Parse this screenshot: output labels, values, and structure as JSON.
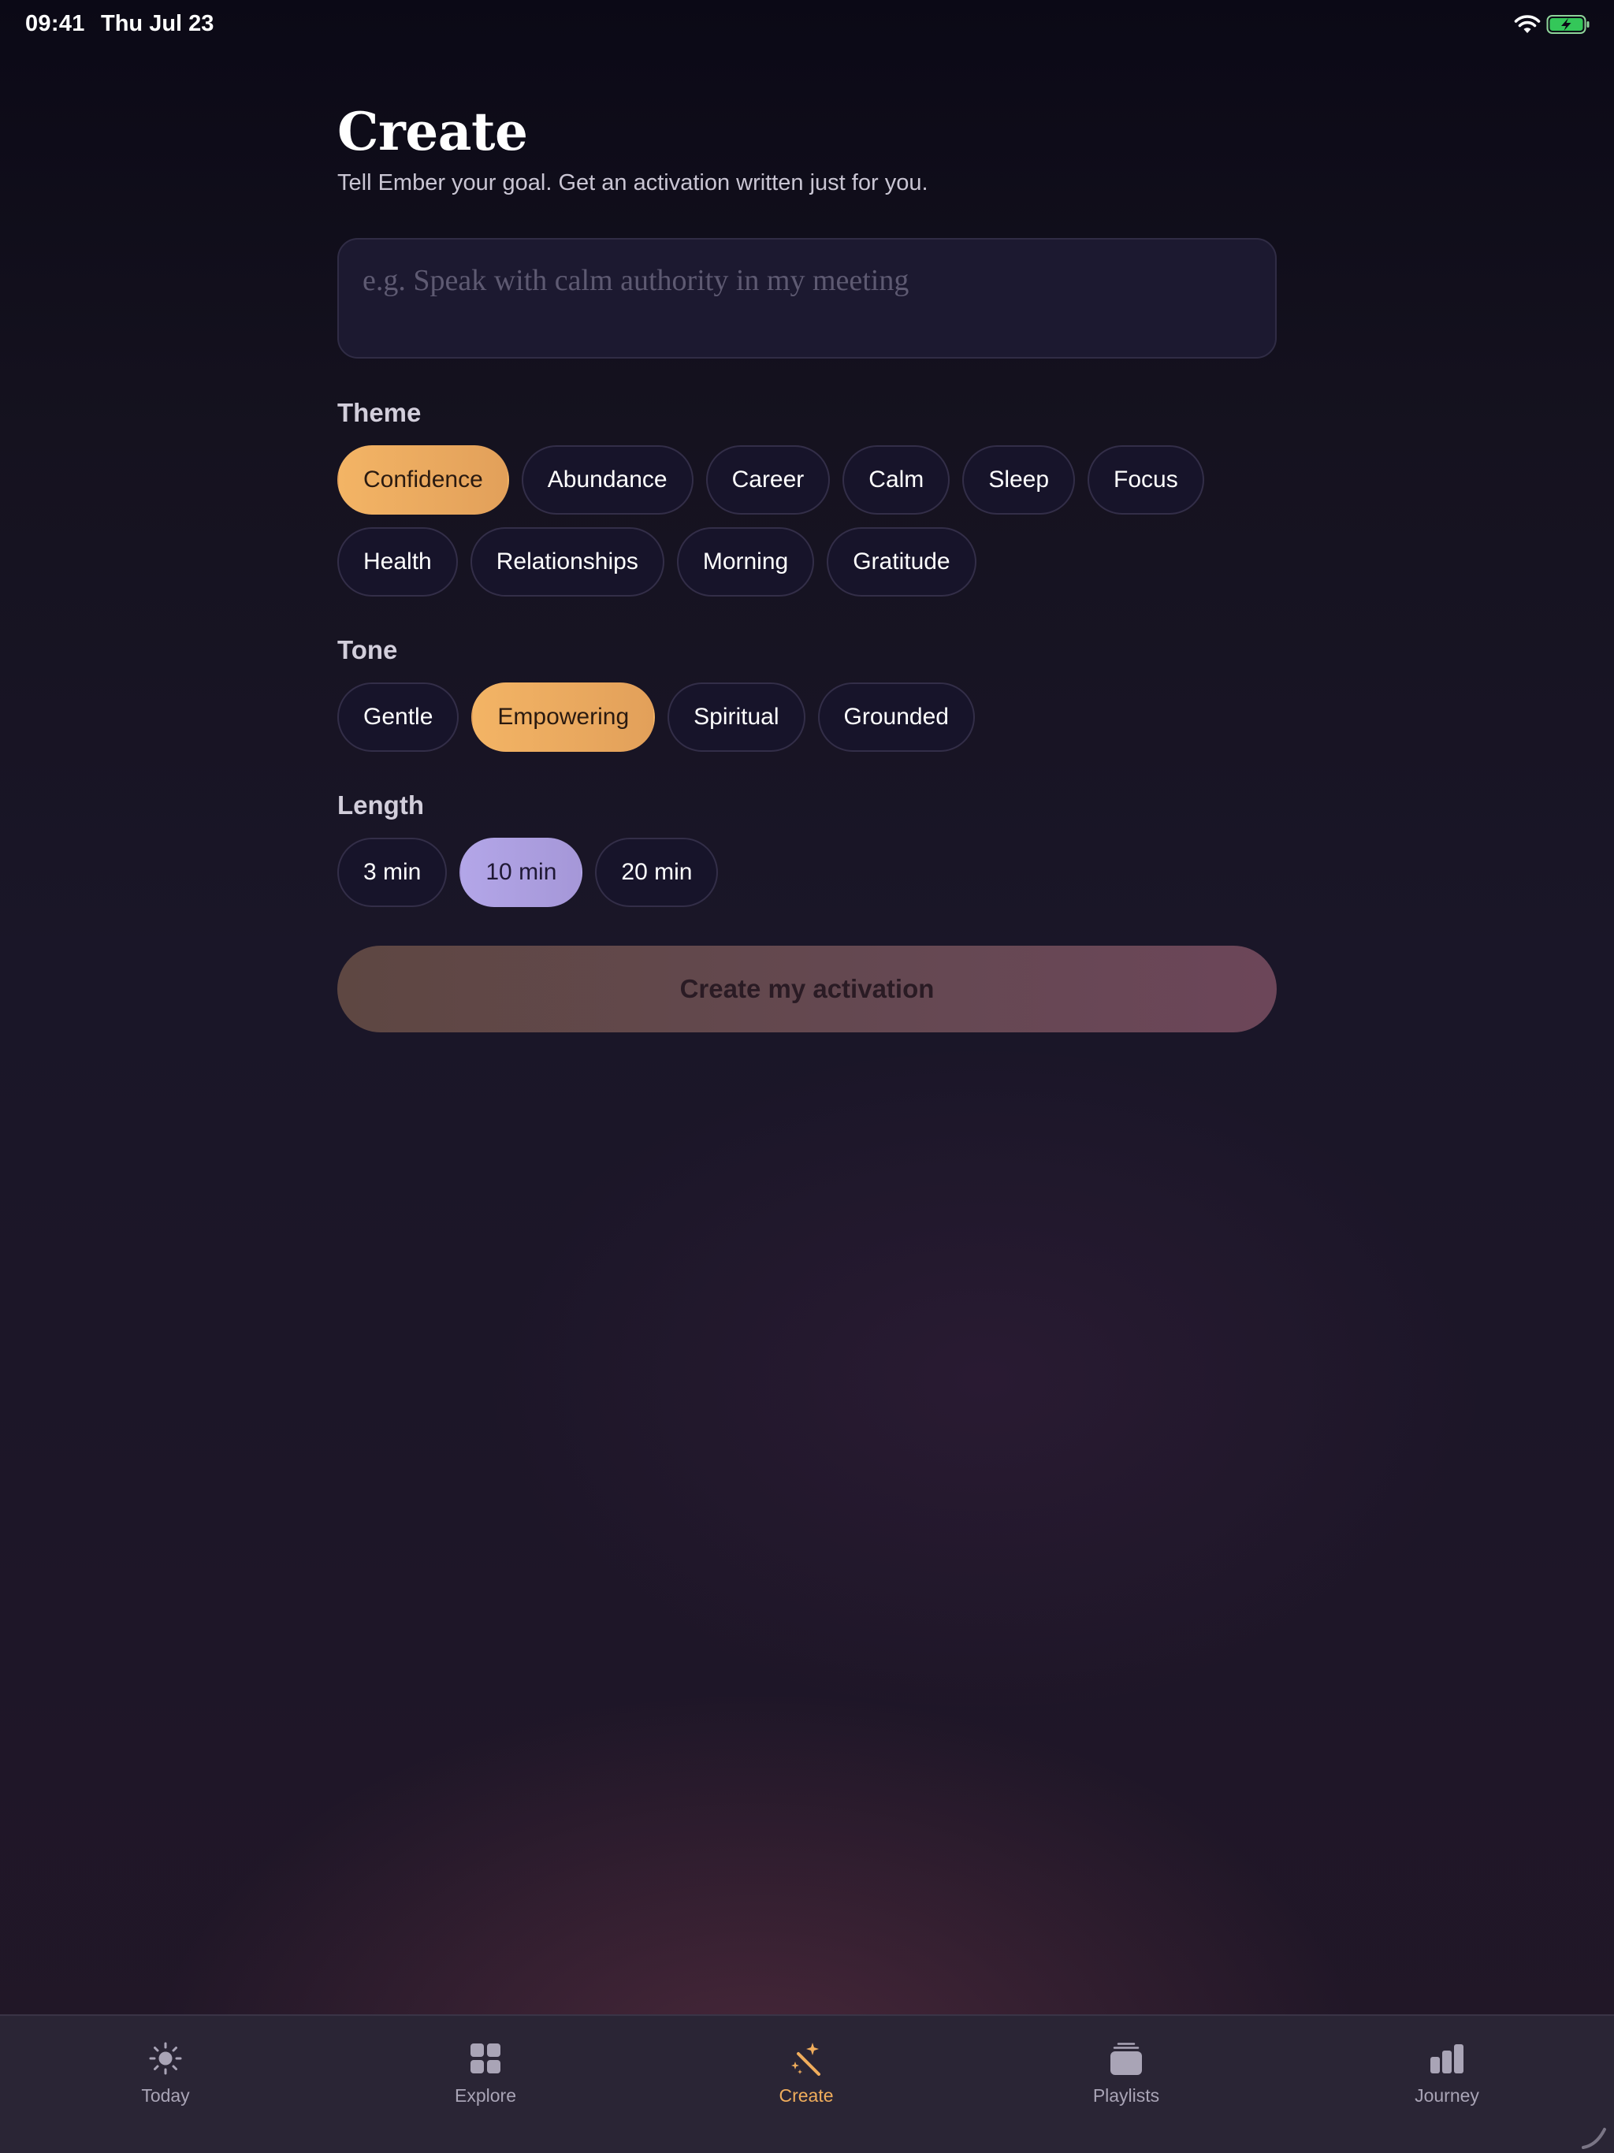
{
  "status_bar": {
    "time": "09:41",
    "date": "Thu Jul 23",
    "icons": [
      "wifi-icon",
      "battery-charging-icon"
    ]
  },
  "header": {
    "title": "Create",
    "subtitle": "Tell Ember your goal. Get an activation written just for you."
  },
  "goal_input": {
    "value": "",
    "placeholder": "e.g. Speak with calm authority in my meeting"
  },
  "theme": {
    "label": "Theme",
    "selected": "Confidence",
    "options": [
      "Confidence",
      "Abundance",
      "Career",
      "Calm",
      "Sleep",
      "Focus",
      "Health",
      "Relationships",
      "Morning",
      "Gratitude"
    ]
  },
  "tone": {
    "label": "Tone",
    "selected": "Empowering",
    "options": [
      "Gentle",
      "Empowering",
      "Spiritual",
      "Grounded"
    ]
  },
  "length": {
    "label": "Length",
    "selected": "10 min",
    "options": [
      "3 min",
      "10 min",
      "20 min"
    ]
  },
  "create_button": {
    "label": "Create my activation"
  },
  "tab_bar": {
    "active": "Create",
    "tabs": [
      {
        "label": "Today",
        "icon": "sun-icon"
      },
      {
        "label": "Explore",
        "icon": "grid-icon"
      },
      {
        "label": "Create",
        "icon": "magic-wand-icon"
      },
      {
        "label": "Playlists",
        "icon": "stack-icon"
      },
      {
        "label": "Journey",
        "icon": "bar-chart-icon"
      }
    ]
  },
  "colors": {
    "accent_orange": "#f0ad5c",
    "accent_lavender": "#b3a6e8",
    "background": "#1a1628",
    "chip_background": "#17142a",
    "tab_bar_background": "#2a2535",
    "battery_green": "#34c759"
  }
}
